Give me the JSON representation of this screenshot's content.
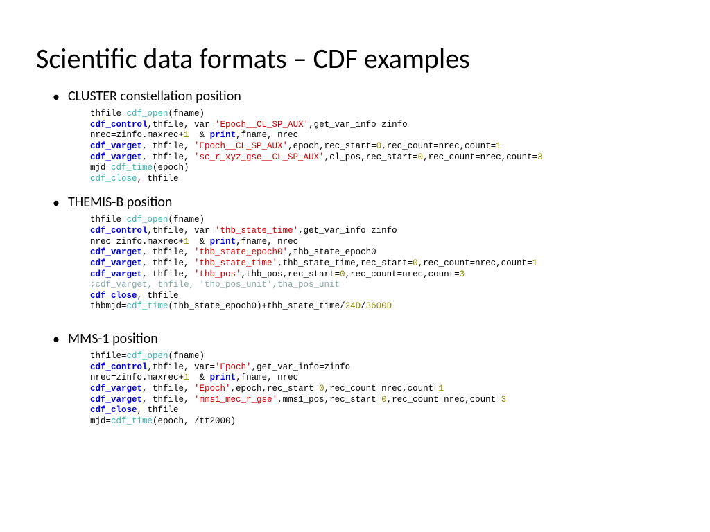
{
  "title": "Scientific data formats – CDF examples",
  "sections": {
    "s1": {
      "bullet": "CLUSTER constellation position"
    },
    "s2": {
      "bullet": "THEMIS-B position"
    },
    "s3": {
      "bullet": "MMS-1 position"
    }
  },
  "code1": {
    "l1a": "thfile=",
    "l1b": "cdf_open",
    "l1c": "(fname)",
    "l2a": "cdf_control",
    "l2b": ",thfile, var=",
    "l2c": "'Epoch__CL_SP_AUX'",
    "l2d": ",get_var_info=zinfo",
    "l3a": "nrec=zinfo.maxrec+",
    "l3b": "1",
    "l3c": "  & ",
    "l3d": "print",
    "l3e": ",fname, nrec",
    "l4a": "cdf_varget",
    "l4b": ", thfile, ",
    "l4c": "'Epoch__CL_SP_AUX'",
    "l4d": ",epoch,rec_start=",
    "l4e": "0",
    "l4f": ",rec_count=nrec,count=",
    "l4g": "1",
    "l5a": "cdf_varget",
    "l5b": ", thfile, ",
    "l5c": "'sc_r_xyz_gse__CL_SP_AUX'",
    "l5d": ",cl_pos,rec_start=",
    "l5e": "0",
    "l5f": ",rec_count=nrec,count=",
    "l5g": "3",
    "l6a": "mjd=",
    "l6b": "cdf_time",
    "l6c": "(epoch)",
    "l7a": "cdf_close",
    "l7b": ", thfile"
  },
  "code2": {
    "l1a": "thfile=",
    "l1b": "cdf_open",
    "l1c": "(fname)",
    "l2a": "cdf_control",
    "l2b": ",thfile, var=",
    "l2c": "'thb_state_time'",
    "l2d": ",get_var_info=zinfo",
    "l3a": "nrec=zinfo.maxrec+",
    "l3b": "1",
    "l3c": "  & ",
    "l3d": "print",
    "l3e": ",fname, nrec",
    "l4a": "cdf_varget",
    "l4b": ", thfile, ",
    "l4c": "'thb_state_epoch0'",
    "l4d": ",thb_state_epoch0",
    "l5a": "cdf_varget",
    "l5b": ", thfile, ",
    "l5c": "'thb_state_time'",
    "l5d": ",thb_state_time,rec_start=",
    "l5e": "0",
    "l5f": ",rec_count=nrec,count=",
    "l5g": "1",
    "l6a": "cdf_varget",
    "l6b": ", thfile, ",
    "l6c": "'thb_pos'",
    "l6d": ",thb_pos,rec_start=",
    "l6e": "0",
    "l6f": ",rec_count=nrec,count=",
    "l6g": "3",
    "l7a": ";cdf_varget, thfile, 'thb_pos_unit',tha_pos_unit",
    "l8a": "cdf_close",
    "l8b": ", thfile",
    "l9a": "thbmjd=",
    "l9b": "cdf_time",
    "l9c": "(thb_state_epoch0)+thb_state_time/",
    "l9d": "24D",
    "l9e": "/",
    "l9f": "3600D"
  },
  "code3": {
    "l1a": "thfile=",
    "l1b": "cdf_open",
    "l1c": "(fname)",
    "l2a": "cdf_control",
    "l2b": ",thfile, var=",
    "l2c": "'Epoch'",
    "l2d": ",get_var_info=zinfo",
    "l3a": "nrec=zinfo.maxrec+",
    "l3b": "1",
    "l3c": "  & ",
    "l3d": "print",
    "l3e": ",fname, nrec",
    "l4a": "cdf_varget",
    "l4b": ", thfile, ",
    "l4c": "'Epoch'",
    "l4d": ",epoch,rec_start=",
    "l4e": "0",
    "l4f": ",rec_count=nrec,count=",
    "l4g": "1",
    "l5a": "cdf_varget",
    "l5b": ", thfile, ",
    "l5c": "'mms1_mec_r_gse'",
    "l5d": ",mms1_pos,rec_start=",
    "l5e": "0",
    "l5f": ",rec_count=nrec,count=",
    "l5g": "3",
    "l6a": "cdf_close",
    "l6b": ", thfile",
    "l7a": "mjd=",
    "l7b": "cdf_time",
    "l7c": "(epoch, /tt2000)"
  }
}
